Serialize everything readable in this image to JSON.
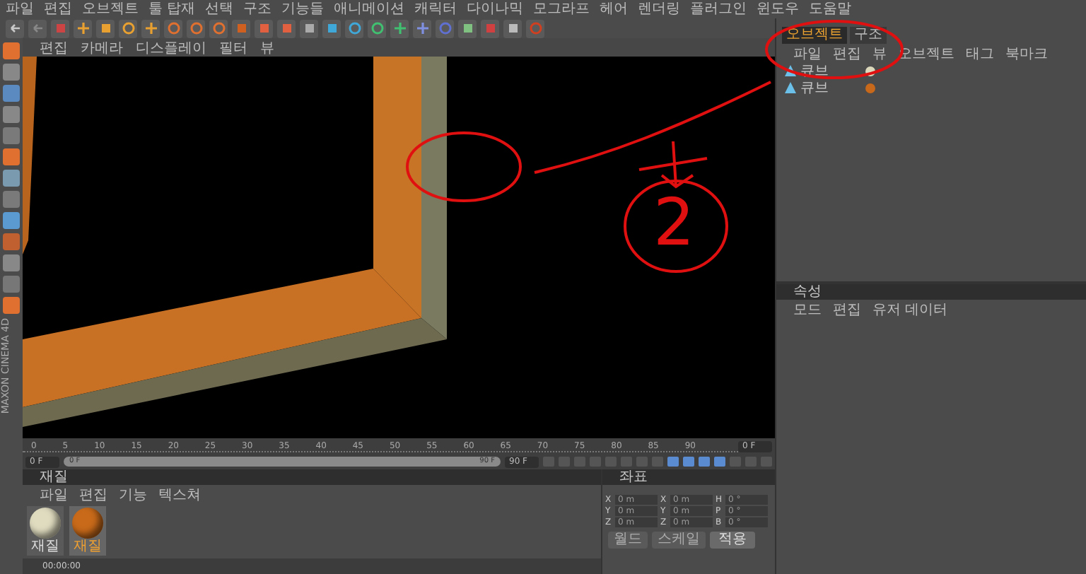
{
  "menu_bar": [
    "파일",
    "편집",
    "오브젝트",
    "툴 탑재",
    "선택",
    "구조",
    "기능들",
    "애니메이션",
    "캐릭터",
    "다이나믹",
    "모그라프",
    "헤어",
    "렌더링",
    "플러그인",
    "윈도우",
    "도움말"
  ],
  "viewport": {
    "menu": [
      "편집",
      "카메라",
      "디스플레이",
      "필터",
      "뷰"
    ],
    "annotation_label": "2"
  },
  "object_manager": {
    "tabs": [
      {
        "label": "오브젝트",
        "selected": true
      },
      {
        "label": "구조",
        "selected": false
      }
    ],
    "menu": [
      "파일",
      "편집",
      "뷰",
      "오브젝트",
      "태그",
      "북마크"
    ],
    "objects": [
      {
        "name": "큐브",
        "color": "#dcd8bc"
      },
      {
        "name": "큐브",
        "color": "#c8681a"
      }
    ]
  },
  "timeline": {
    "ticks": [
      "0",
      "5",
      "10",
      "15",
      "20",
      "25",
      "30",
      "35",
      "40",
      "45",
      "50",
      "55",
      "60",
      "65",
      "70",
      "75",
      "80",
      "85",
      "90"
    ],
    "current": "0 F",
    "start": "0 F",
    "level": 1,
    "range_start": "0 F",
    "range_end": "90 F",
    "end": "90 F"
  },
  "material_manager": {
    "title": "재질",
    "menu": [
      "파일",
      "편집",
      "기능",
      "텍스쳐"
    ],
    "materials": [
      {
        "name": "재질",
        "color": "#e0dcc0",
        "selected": false
      },
      {
        "name": "재질",
        "color": "#c86a1a",
        "selected": true
      }
    ]
  },
  "coordinates": {
    "title": "좌표",
    "rows": [
      {
        "axis": "X",
        "position": "0 m",
        "size_axis": "X",
        "size": "0 m",
        "rot_axis": "H",
        "rotation": "0 °"
      },
      {
        "axis": "Y",
        "position": "0 m",
        "size_axis": "Y",
        "size": "0 m",
        "rot_axis": "P",
        "rotation": "0 °"
      },
      {
        "axis": "Z",
        "position": "0 m",
        "size_axis": "Z",
        "size": "0 m",
        "rot_axis": "B",
        "rotation": "0 °"
      }
    ],
    "dropdowns": [
      "월드",
      "스케일"
    ],
    "apply_button": "적용"
  },
  "attributes": {
    "title": "속성",
    "menu": [
      "모드",
      "편집",
      "유저 데이터"
    ]
  },
  "status_bar": {
    "text": "00:00:00"
  },
  "brand": "MAXON CINEMA 4D"
}
